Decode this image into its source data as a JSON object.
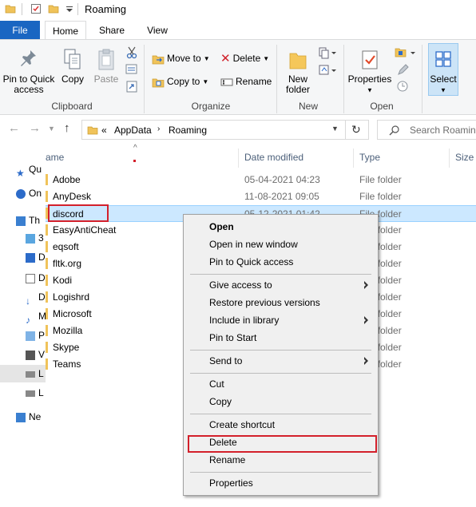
{
  "window": {
    "title": "Roaming"
  },
  "tabs": [
    {
      "label": "File"
    },
    {
      "label": "Home"
    },
    {
      "label": "Share"
    },
    {
      "label": "View"
    }
  ],
  "ribbon": {
    "clipboard": {
      "pin_label_1": "Pin to Quick",
      "pin_label_2": "access",
      "copy": "Copy",
      "paste": "Paste",
      "group": "Clipboard"
    },
    "organize": {
      "move_to": "Move to",
      "copy_to": "Copy to",
      "delete": "Delete",
      "rename": "Rename",
      "group": "Organize"
    },
    "new": {
      "new_folder_1": "New",
      "new_folder_2": "folder",
      "group": "New"
    },
    "open": {
      "properties": "Properties",
      "group": "Open"
    },
    "select": {
      "label": "Select"
    }
  },
  "address": {
    "prefix": "«",
    "crumb1": "AppData",
    "crumb2": "Roaming",
    "search_placeholder": "Search Roaming"
  },
  "nav_pane": [
    {
      "label": "Qu"
    },
    {
      "label": "On"
    },
    {
      "label": "Th"
    },
    {
      "label": "3"
    },
    {
      "label": "D"
    },
    {
      "label": "D"
    },
    {
      "label": "D"
    },
    {
      "label": "M"
    },
    {
      "label": "P"
    },
    {
      "label": "V"
    },
    {
      "label": "L"
    },
    {
      "label": "L"
    },
    {
      "label": "Ne"
    }
  ],
  "columns": {
    "name": "ame",
    "date": "Date modified",
    "type": "Type",
    "size": "Size"
  },
  "files": [
    {
      "name": "Adobe",
      "date": "05-04-2021 04:23",
      "type": "File folder"
    },
    {
      "name": "AnyDesk",
      "date": "11-08-2021 09:05",
      "type": "File folder"
    },
    {
      "name": "discord",
      "date": "05-12-2021 01:42",
      "type": "File folder"
    },
    {
      "name": "EasyAntiCheat",
      "date": "",
      "type": "File folder"
    },
    {
      "name": "eqsoft",
      "date": "",
      "type": "File folder"
    },
    {
      "name": "fltk.org",
      "date": "",
      "type": "File folder"
    },
    {
      "name": "Kodi",
      "date": "",
      "type": "File folder"
    },
    {
      "name": "Logishrd",
      "date": "",
      "type": "File folder"
    },
    {
      "name": "Microsoft",
      "date": "",
      "type": "File folder"
    },
    {
      "name": "Mozilla",
      "date": "",
      "type": "File folder"
    },
    {
      "name": "Skype",
      "date": "",
      "type": "File folder"
    },
    {
      "name": "Teams",
      "date": "",
      "type": "File folder"
    }
  ],
  "context_menu": {
    "open": "Open",
    "open_new_window": "Open in new window",
    "pin_quick": "Pin to Quick access",
    "give_access": "Give access to",
    "restore": "Restore previous versions",
    "include_library": "Include in library",
    "pin_start": "Pin to Start",
    "send_to": "Send to",
    "cut": "Cut",
    "copy": "Copy",
    "create_shortcut": "Create shortcut",
    "delete": "Delete",
    "rename": "Rename",
    "properties": "Properties"
  },
  "colors": {
    "accent": "#1a66c2",
    "selection": "#cce8ff",
    "highlight_box": "#d3202b"
  }
}
